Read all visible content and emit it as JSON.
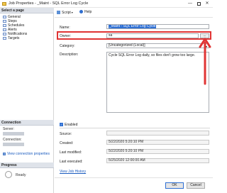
{
  "window": {
    "title": "Job Properties - _Maint - SQL Error Log Cycle",
    "min_glyph": "—",
    "close_glyph": "✕"
  },
  "sidebar": {
    "select_page_header": "Select a page",
    "pages": [
      {
        "label": "General"
      },
      {
        "label": "Steps"
      },
      {
        "label": "Schedules"
      },
      {
        "label": "Alerts"
      },
      {
        "label": "Notifications"
      },
      {
        "label": "Targets"
      }
    ],
    "connection_header": "Connection",
    "server_label": "Server:",
    "connection_label": "Connection:",
    "view_connection_link": "View connection properties",
    "progress_header": "Progress",
    "progress_status": "Ready"
  },
  "toolbar": {
    "script_label": "Script",
    "help_label": "Help"
  },
  "form": {
    "name_label": "Name:",
    "name_value": "_Maint - SQL Error Log Cycle",
    "owner_label": "Owner:",
    "owner_value": "sa",
    "owner_browse_label": "...",
    "category_label": "Category:",
    "category_value": "[Uncategorized (Local)]",
    "description_label": "Description:",
    "description_value": "Cycle SQL Error Log daily, so files don't grow too large.",
    "enabled_label": "Enabled",
    "enabled_checked": true,
    "source_label": "Source:",
    "source_value": "",
    "created_label": "Created:",
    "created_value": "5/22/2020 5:20:10 PM",
    "last_modified_label": "Last modified:",
    "last_modified_value": "5/22/2020 5:20:10 PM",
    "last_executed_label": "Last executed:",
    "last_executed_value": "5/25/2020 12:00:00 AM",
    "view_history_link": "View Job History"
  },
  "footer": {
    "ok_label": "OK",
    "cancel_label": "Cancel"
  },
  "colors": {
    "highlight_border": "#e03434",
    "selection": "#2e6fd3",
    "link": "#1a5bbf"
  },
  "icons": {
    "window_icon": "job-icon",
    "script_icon": "script-icon",
    "help_icon": "help-icon",
    "page_icon": "page-icon",
    "connection_icon": "connection-icon",
    "progress_icon": "spinner-icon",
    "annotation_arrow": "red-arrow-icon"
  }
}
